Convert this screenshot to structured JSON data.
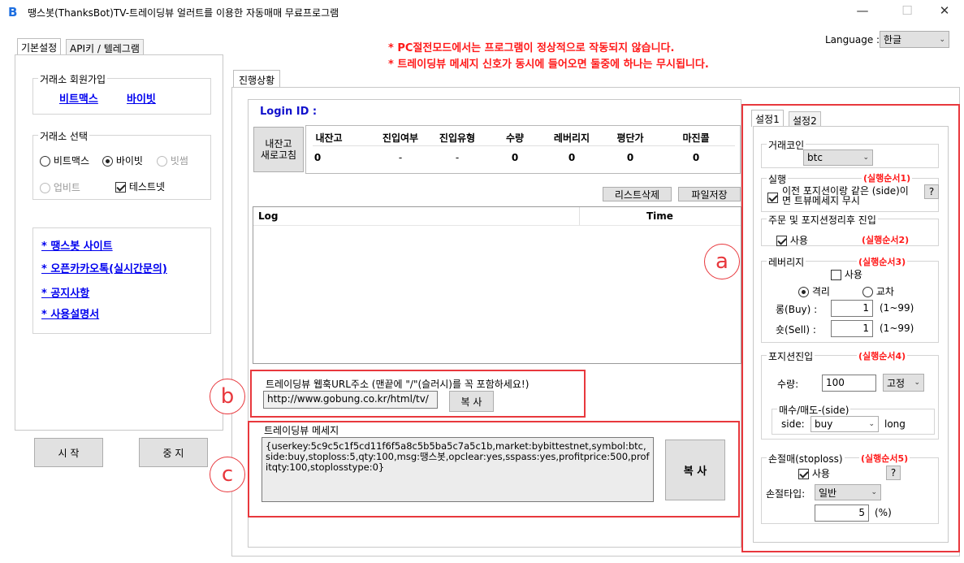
{
  "window": {
    "title": "땡스봇(ThanksBot)TV-트레이딩뷰 얼러트를 이용한 자동매매 무료프로그램",
    "icon": "B"
  },
  "notices": [
    "* PC절전모드에서는 프로그램이 정상적으로 작동되지 않습니다.",
    "* 트레이딩뷰 메세지 신호가 동시에 들어오면 둘중에 하나는 무시됩니다."
  ],
  "language": {
    "label": "Language :",
    "value": "한글"
  },
  "left_tabs": [
    "기본설정",
    "API키 / 텔레그램"
  ],
  "signup": {
    "title": "거래소 회원가입",
    "links": [
      "비트맥스",
      "바이빗"
    ]
  },
  "exchange": {
    "title": "거래소 선택",
    "options": [
      "비트맥스",
      "바이빗",
      "빗썸",
      "업비트"
    ],
    "testnet": "테스트넷"
  },
  "site_links": [
    "* 땡스봇 사이트",
    "* 오픈카카오톡(실시간문의)",
    "* 공지사항",
    "* 사용설명서"
  ],
  "start_button": "시 작",
  "stop_button": "중 지",
  "progress_tab": "진행상황",
  "login_label": "Login ID :",
  "refresh_button": "내잔고\n새로고침",
  "status_table": {
    "headers": [
      "내잔고",
      "진입여부",
      "진입유형",
      "수량",
      "레버리지",
      "평단가",
      "마진콜"
    ],
    "values": [
      "0",
      "-",
      "-",
      "0",
      "0",
      "0",
      "0"
    ]
  },
  "list_delete_button": "리스트삭제",
  "file_save_button": "파일저장",
  "log_headers": [
    "Log",
    "Time"
  ],
  "webhook": {
    "label": "트레이딩뷰 웹훅URL주소 (맨끝에 \"/\"(슬러시)를 꼭 포함하세요!)",
    "url": "http://www.gobung.co.kr/html/tv/",
    "copy": "복 사"
  },
  "message": {
    "label": "트레이딩뷰 메세지",
    "text": "{userkey:5c9c5c1f5cd11f6f5a8c5b5ba5c7a5c1b,market:bybittestnet,symbol:btc,side:buy,stoploss:5,qty:100,msg:땡스봇,opclear:yes,sspass:yes,profitprice:500,profitqty:100,stoplosstype:0}",
    "copy": "복 사"
  },
  "settings_tabs": [
    "설정1",
    "설정2"
  ],
  "coin": {
    "title": "거래코인",
    "value": "btc"
  },
  "execution": {
    "title": "실행",
    "order": "(실행순서1)",
    "check_text": "이전 포지션이랑 같은 (side)이면 트뷰메세지 무시",
    "help": "?"
  },
  "order_entry": {
    "title": "주문 및 포지션정리후 진입",
    "use": "사용",
    "order": "(실행순서2)"
  },
  "leverage": {
    "title": "레버리지",
    "order": "(실행순서3)",
    "use": "사용",
    "isolated": "격리",
    "cross": "교차",
    "long_label": "롱(Buy) :",
    "long_value": "1",
    "short_label": "숏(Sell) :",
    "short_value": "1",
    "range": "(1~99)"
  },
  "position": {
    "title": "포지션진입",
    "order": "(실행순서4)",
    "qty_label": "수량:",
    "qty_value": "100",
    "qty_type": "고정",
    "side_group": "매수/매도-(side)",
    "side_label": "side:",
    "side_value": "buy",
    "side_hint": "long"
  },
  "stoploss": {
    "title": "손절매(stoploss)",
    "order": "(실행순서5)",
    "use": "사용",
    "help": "?",
    "type_label": "손절타입:",
    "type_value": "일반",
    "value": "5",
    "unit": "(%)"
  },
  "annotations": [
    "a",
    "b",
    "c"
  ],
  "colors": {
    "accent_red": "#e8383d",
    "notice_red": "#ff1a1a",
    "link_blue": "#0000ee",
    "button_gray": "#e1e1e1"
  }
}
